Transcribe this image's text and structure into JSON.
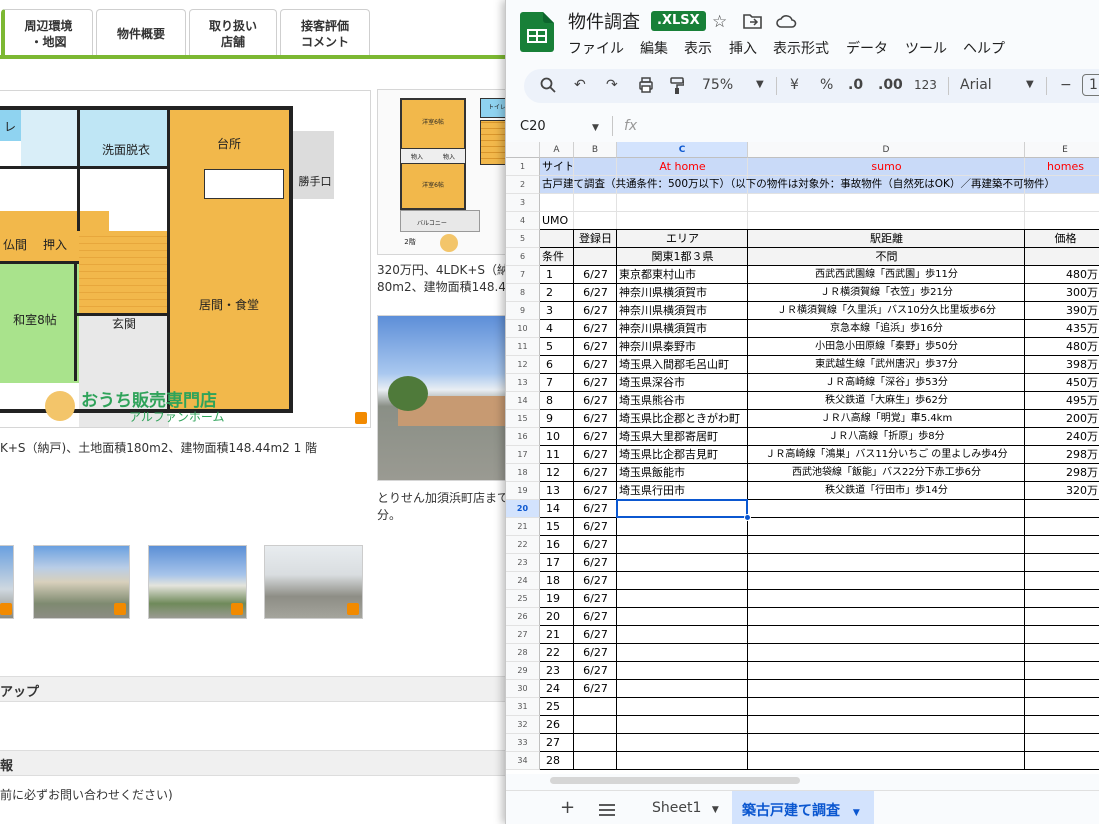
{
  "web": {
    "tabs": [
      {
        "label": "周辺環境\n・地図"
      },
      {
        "label": "物件概要"
      },
      {
        "label": "取り扱い\n店舗"
      },
      {
        "label": "接客評価\nコメント"
      }
    ],
    "floorplan_rooms": {
      "bath": "レ",
      "washroom": "洗面脱衣",
      "kitchen": "台所",
      "back_door": "勝手口",
      "butsuma": "仏間",
      "oshiire": "押入",
      "japanese_room": "和室8帖",
      "entrance": "玄関",
      "living": "居間・食堂"
    },
    "logo_main": "おうち販売専門店",
    "logo_sub": "アルファンホーム",
    "caption_main": "K+S（納戸)、土地面積180m2、建物面積148.44m2 1 階",
    "small_plan_labels": {
      "western1": "洋室6帖",
      "western2": "洋室6帖",
      "storage1": "物入",
      "storage2": "物入",
      "toilet": "トイレ",
      "balcony": "バルコニー",
      "floor": "2階"
    },
    "caption_right": "320万円、4LDK+S（納\n80m2、建物面積148.4",
    "caption_shop": "とりせん加須浜町店まで\n分。",
    "section_app": "アップ",
    "section_info": "報",
    "note": "前に必ずお問い合わせください)"
  },
  "sheets": {
    "title": "物件調査",
    "badge": ".XLSX",
    "menu": [
      "ファイル",
      "編集",
      "表示",
      "挿入",
      "表示形式",
      "データ",
      "ツール",
      "ヘルプ"
    ],
    "toolbar": {
      "zoom": "75%",
      "currency": "¥",
      "percent": "%",
      "dec_decrease": ".0",
      "dec_increase": ".00",
      "number_format": "123",
      "font": "Arial",
      "minus": "−",
      "font_size": "1"
    },
    "name_box": "C20",
    "fx_label": "fx",
    "columns": [
      "A",
      "B",
      "C",
      "D",
      "E"
    ],
    "row_numbers": [
      "1",
      "2",
      "3",
      "4",
      "5",
      "6",
      "7",
      "8",
      "9",
      "10",
      "11",
      "12",
      "13",
      "14",
      "15",
      "16",
      "17",
      "18",
      "19",
      "20",
      "21",
      "22",
      "23",
      "24",
      "25",
      "26",
      "27",
      "28",
      "29",
      "30",
      "31",
      "32",
      "33",
      "34"
    ],
    "row1": {
      "a": "サイト",
      "c": "At home",
      "d": "sumo",
      "e": "homes"
    },
    "row2": "古戸建て調査（共通条件：500万以下）（以下の物件は対象外：事故物件（自然死はOK）／再建築不可物件）",
    "row4": "UMO",
    "header": {
      "b": "登録日",
      "c": "エリア",
      "d": "駅距離",
      "e": "価格"
    },
    "row6": {
      "a": "条件",
      "c": "関東1都３県",
      "d": "不問"
    },
    "records": [
      {
        "no": "1",
        "date": "6/27",
        "area": "東京都東村山市",
        "station": "西武西武園線「西武園」歩11分",
        "price": "480万"
      },
      {
        "no": "2",
        "date": "6/27",
        "area": "神奈川県横須賀市",
        "station": "ＪＲ横須賀線「衣笠」歩21分",
        "price": "300万"
      },
      {
        "no": "3",
        "date": "6/27",
        "area": "神奈川県横須賀市",
        "station": "ＪＲ横須賀線「久里浜」バス10分久比里坂歩6分",
        "price": "390万"
      },
      {
        "no": "4",
        "date": "6/27",
        "area": "神奈川県横須賀市",
        "station": "京急本線「追浜」歩16分",
        "price": "435万"
      },
      {
        "no": "5",
        "date": "6/27",
        "area": "神奈川県秦野市",
        "station": "小田急小田原線「秦野」歩50分",
        "price": "480万"
      },
      {
        "no": "6",
        "date": "6/27",
        "area": "埼玉県入間郡毛呂山町",
        "station": "東武越生線「武州唐沢」歩37分",
        "price": "398万"
      },
      {
        "no": "7",
        "date": "6/27",
        "area": "埼玉県深谷市",
        "station": "ＪＲ高崎線「深谷」歩53分",
        "price": "450万"
      },
      {
        "no": "8",
        "date": "6/27",
        "area": "埼玉県熊谷市",
        "station": "秩父鉄道「大麻生」歩62分",
        "price": "495万"
      },
      {
        "no": "9",
        "date": "6/27",
        "area": "埼玉県比企郡ときがわ町",
        "station": "ＪＲ八高線「明覚」車5.4km",
        "price": "200万"
      },
      {
        "no": "10",
        "date": "6/27",
        "area": "埼玉県大里郡寄居町",
        "station": "ＪＲ八高線「折原」歩8分",
        "price": "240万"
      },
      {
        "no": "11",
        "date": "6/27",
        "area": "埼玉県比企郡吉見町",
        "station": "ＪＲ高崎線「鴻巣」バス11分いちご の里よしみ歩4分",
        "price": "298万"
      },
      {
        "no": "12",
        "date": "6/27",
        "area": "埼玉県飯能市",
        "station": "西武池袋線「飯能」バス22分下赤工歩6分",
        "price": "298万"
      },
      {
        "no": "13",
        "date": "6/27",
        "area": "埼玉県行田市",
        "station": "秩父鉄道「行田市」歩14分",
        "price": "320万"
      },
      {
        "no": "14",
        "date": "6/27",
        "area": "",
        "station": "",
        "price": ""
      },
      {
        "no": "15",
        "date": "6/27",
        "area": "",
        "station": "",
        "price": ""
      },
      {
        "no": "16",
        "date": "6/27",
        "area": "",
        "station": "",
        "price": ""
      },
      {
        "no": "17",
        "date": "6/27",
        "area": "",
        "station": "",
        "price": ""
      },
      {
        "no": "18",
        "date": "6/27",
        "area": "",
        "station": "",
        "price": ""
      },
      {
        "no": "19",
        "date": "6/27",
        "area": "",
        "station": "",
        "price": ""
      },
      {
        "no": "20",
        "date": "6/27",
        "area": "",
        "station": "",
        "price": ""
      },
      {
        "no": "21",
        "date": "6/27",
        "area": "",
        "station": "",
        "price": ""
      },
      {
        "no": "22",
        "date": "6/27",
        "area": "",
        "station": "",
        "price": ""
      },
      {
        "no": "23",
        "date": "6/27",
        "area": "",
        "station": "",
        "price": ""
      },
      {
        "no": "24",
        "date": "6/27",
        "area": "",
        "station": "",
        "price": ""
      },
      {
        "no": "25",
        "date": "",
        "area": "",
        "station": "",
        "price": ""
      },
      {
        "no": "26",
        "date": "",
        "area": "",
        "station": "",
        "price": ""
      },
      {
        "no": "27",
        "date": "",
        "area": "",
        "station": "",
        "price": ""
      },
      {
        "no": "28",
        "date": "",
        "area": "",
        "station": "",
        "price": ""
      }
    ],
    "sheet_tabs": [
      "Sheet1",
      "築古戸建て調査"
    ],
    "colors": {
      "accent": "#0b57d0",
      "green": "#188038",
      "red_text": "#ff0000",
      "row1_bg": "#c9daf8",
      "active_tab_bg": "#d3e3fd"
    }
  }
}
